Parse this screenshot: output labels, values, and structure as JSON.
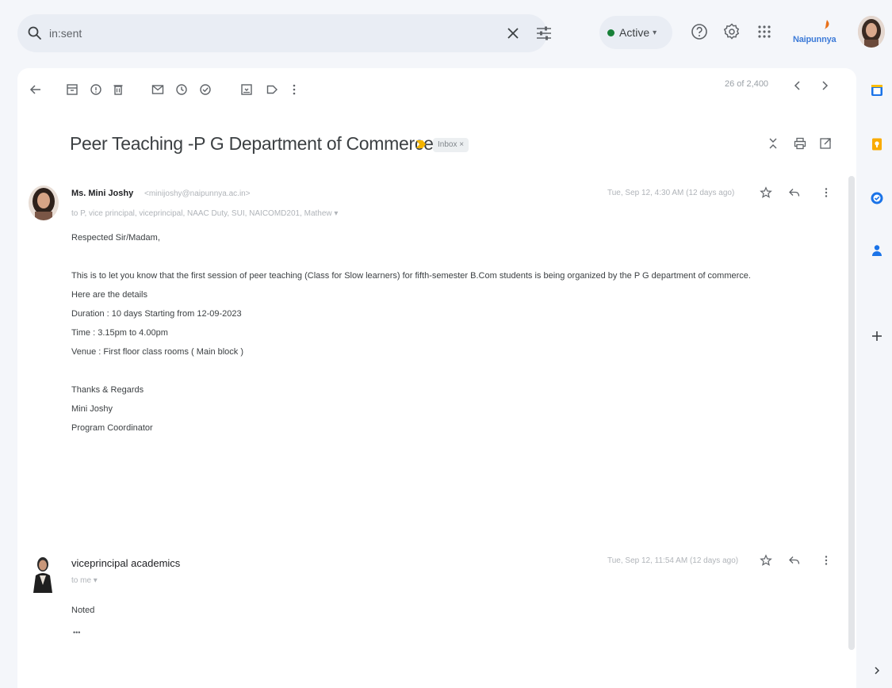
{
  "search": {
    "value": "in:sent",
    "icon": "search-icon",
    "clear_icon": "close-icon",
    "filter_icon": "tune-icon"
  },
  "status": {
    "label": "Active",
    "color": "#188038"
  },
  "top_icons": [
    "help-icon",
    "settings-icon",
    "apps-icon"
  ],
  "brand": {
    "name": "Naipunnya",
    "color": "#3d7bd8"
  },
  "toolbar": {
    "icons": [
      "back-arrow-icon",
      "archive-icon",
      "report-spam-icon",
      "delete-icon",
      "mark-unread-icon",
      "snooze-icon",
      "add-task-icon",
      "move-to-icon",
      "label-icon",
      "more-vert-icon"
    ],
    "pager": "26 of 2,400"
  },
  "thread": {
    "subject": "Peer Teaching -P G Department of Commerce",
    "label": "Inbox ×",
    "important_color": "#f4b400"
  },
  "messages": [
    {
      "sender": "Ms. Mini Joshy",
      "email": "<minijoshy@naipunnya.ac.in>",
      "recipients": "to P, vice principal, viceprincipal, NAAC Duty, SUI, NAICOMD201, Mathew ▾",
      "date": "Tue, Sep 12, 4:30 AM (12 days ago)",
      "greeting": "Respected Sir/Madam,",
      "paragraph": "This is to let you know that the first session of peer teaching (Class for Slow learners) for fifth-semester B.Com students is being organized by the P G department of commerce.",
      "details_intro": "Here are the details",
      "details": [
        "Duration  :  10 days  Starting from 12-09-2023",
        "Time        :  3.15pm to 4.00pm",
        "Venue     :  First floor class rooms ( Main block )"
      ],
      "signature": [
        "Thanks & Regards",
        "Mini Joshy",
        "Program Coordinator"
      ]
    },
    {
      "sender": "viceprincipal academics",
      "recipients": "to me ▾",
      "date": "Tue, Sep 12, 11:54 AM (12 days ago)",
      "body": "Noted",
      "ellipsis": "•••"
    }
  ],
  "right_rail": {
    "icons": [
      "calendar-icon",
      "keep-icon",
      "tasks-icon",
      "contacts-icon",
      "add-icon",
      "expand-chevron-icon"
    ],
    "calendar_color": "#1a73e8",
    "keep_color": "#f9ab00",
    "tasks_color": "#1a73e8",
    "contacts_color": "#1a73e8"
  }
}
